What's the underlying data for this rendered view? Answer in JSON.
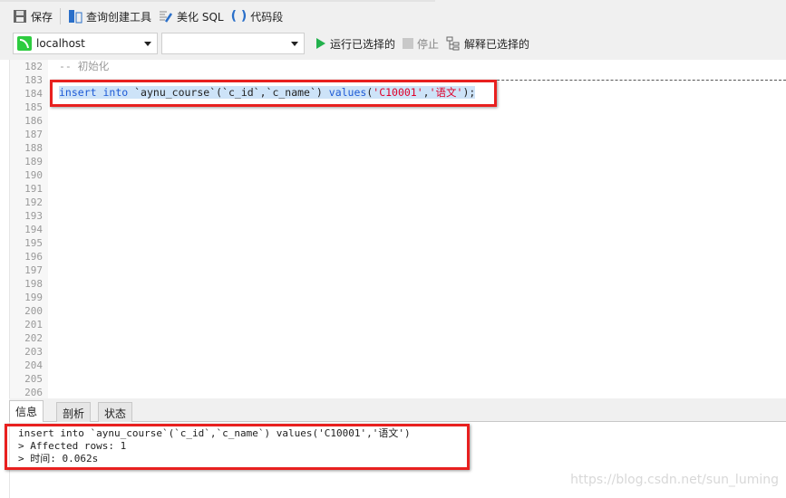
{
  "toolbar": {
    "save": "保存",
    "query_builder": "查询创建工具",
    "beautify": "美化 SQL",
    "snippet": "代码段"
  },
  "run_bar": {
    "connection": "localhost",
    "database": "",
    "run_selected": "运行已选择的",
    "stop": "停止",
    "explain_selected": "解释已选择的"
  },
  "editor": {
    "line_numbers": [
      "182",
      "183",
      "184",
      "185",
      "186",
      "187",
      "188",
      "189",
      "190",
      "191",
      "192",
      "193",
      "194",
      "195",
      "196",
      "197",
      "198",
      "199",
      "200",
      "201",
      "202",
      "203",
      "204",
      "205",
      "206"
    ],
    "comment": "-- 初始化",
    "code": {
      "kw1": "insert",
      "kw2": "into",
      "table": "`aynu_course`(`c_id`,`c_name`)",
      "kw3": "values",
      "open": "(",
      "s1": "'C10001'",
      "comma": ",",
      "s2": "'语文'",
      "close": ");"
    }
  },
  "tabs": [
    "信息",
    "剖析",
    "状态"
  ],
  "messages": [
    "insert into `aynu_course`(`c_id`,`c_name`) values('C10001','语文')",
    "> Affected rows: 1",
    "> 时间: 0.062s"
  ],
  "watermark": "https://blog.csdn.net/sun_luming",
  "colors": {
    "highlight_box": "#e8201f",
    "keyword": "#1e5bd6",
    "string": "#e0002a",
    "run_icon": "#22b14c"
  }
}
